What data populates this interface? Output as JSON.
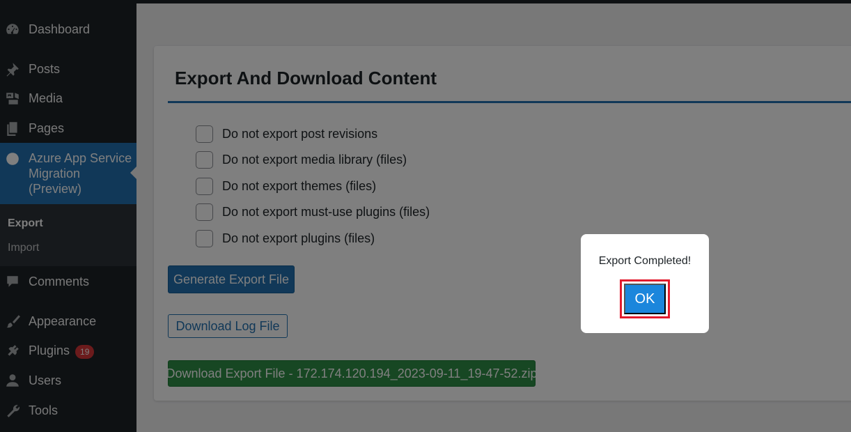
{
  "sidebar": {
    "items": [
      {
        "key": "dashboard",
        "label": "Dashboard",
        "icon": "dashboard-icon"
      },
      {
        "key": "posts",
        "label": "Posts",
        "icon": "pin-icon"
      },
      {
        "key": "media",
        "label": "Media",
        "icon": "media-icon"
      },
      {
        "key": "pages",
        "label": "Pages",
        "icon": "pages-icon"
      },
      {
        "key": "azure",
        "label": "Azure App Service Migration (Preview)",
        "icon": "azure-icon"
      },
      {
        "key": "comments",
        "label": "Comments",
        "icon": "comment-icon"
      },
      {
        "key": "appearance",
        "label": "Appearance",
        "icon": "brush-icon"
      },
      {
        "key": "plugins",
        "label": "Plugins",
        "icon": "plug-icon",
        "badge": "19"
      },
      {
        "key": "users",
        "label": "Users",
        "icon": "user-icon"
      },
      {
        "key": "tools",
        "label": "Tools",
        "icon": "wrench-icon"
      }
    ],
    "submenu": [
      {
        "label": "Export",
        "current": true
      },
      {
        "label": "Import",
        "current": false
      }
    ]
  },
  "main": {
    "title": "Export And Download Content",
    "options": [
      {
        "label": "Do not export post revisions",
        "checked": false
      },
      {
        "label": "Do not export media library (files)",
        "checked": false
      },
      {
        "label": "Do not export themes (files)",
        "checked": false
      },
      {
        "label": "Do not export must-use plugins (files)",
        "checked": false
      },
      {
        "label": "Do not export plugins (files)",
        "checked": false
      }
    ],
    "generate_button": "Generate Export File",
    "log_button": "Download Log File",
    "download_button": "Download Export File - 172.174.120.194_2023-09-11_19-47-52.zip"
  },
  "modal": {
    "message": "Export Completed!",
    "ok_label": "OK"
  },
  "colors": {
    "sidebar_bg": "#1d2327",
    "accent": "#2271b1",
    "success": "#2e8f46",
    "badge": "#d63638",
    "highlight_border": "#e21b2d"
  }
}
